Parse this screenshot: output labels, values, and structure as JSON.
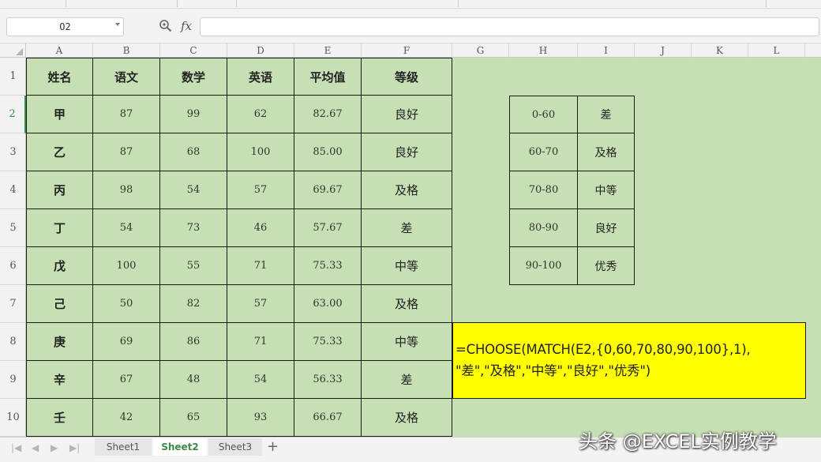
{
  "formula_bar": {
    "name_box": "O2",
    "fx_label": "fx",
    "formula": ""
  },
  "columns": [
    "A",
    "B",
    "C",
    "D",
    "E",
    "F",
    "G",
    "H",
    "I",
    "J",
    "K",
    "L"
  ],
  "rows": [
    "1",
    "2",
    "3",
    "4",
    "5",
    "6",
    "7",
    "8",
    "9",
    "10"
  ],
  "active_row": "2",
  "table": {
    "headers": [
      "姓名",
      "语文",
      "数学",
      "英语",
      "平均值",
      "等级"
    ],
    "rows": [
      [
        "甲",
        "87",
        "99",
        "62",
        "82.67",
        "良好"
      ],
      [
        "乙",
        "87",
        "68",
        "100",
        "85.00",
        "良好"
      ],
      [
        "丙",
        "98",
        "54",
        "57",
        "69.67",
        "及格"
      ],
      [
        "丁",
        "54",
        "73",
        "46",
        "57.67",
        "差"
      ],
      [
        "戊",
        "100",
        "55",
        "71",
        "75.33",
        "中等"
      ],
      [
        "己",
        "50",
        "82",
        "57",
        "63.00",
        "及格"
      ],
      [
        "庚",
        "69",
        "86",
        "71",
        "75.33",
        "中等"
      ],
      [
        "辛",
        "67",
        "48",
        "54",
        "56.33",
        "差"
      ],
      [
        "壬",
        "42",
        "65",
        "93",
        "66.67",
        "及格"
      ]
    ]
  },
  "lookup_table": [
    [
      "0-60",
      "差"
    ],
    [
      "60-70",
      "及格"
    ],
    [
      "70-80",
      "中等"
    ],
    [
      "80-90",
      "良好"
    ],
    [
      "90-100",
      "优秀"
    ]
  ],
  "formula_note": {
    "line1": "=CHOOSE(MATCH(E2,{0,60,70,80,90,100},1),",
    "line2": "\"差\",\"及格\",\"中等\",\"良好\",\"优秀\")"
  },
  "sheet_tabs": [
    "Sheet1",
    "Sheet2",
    "Sheet3"
  ],
  "active_sheet": "Sheet2",
  "add_sheet": "+",
  "watermark": "头条 @EXCEL实例教学",
  "colors": {
    "cell_fill": "#c6e0b4",
    "highlight_fill": "#ffff00",
    "active_accent": "#3a8d44"
  }
}
